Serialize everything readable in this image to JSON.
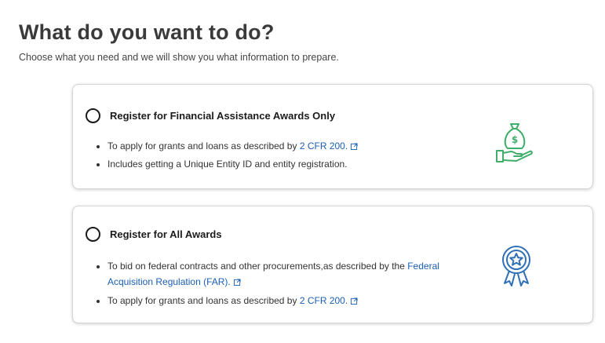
{
  "header": {
    "title": "What do you want to do?",
    "subtitle": "Choose what you need and we will show you what information to prepare."
  },
  "options": [
    {
      "label": "Register for Financial Assistance Awards Only",
      "icon": "money-bag-hand-icon",
      "bullet1_text": "To apply for grants and loans as described by ",
      "bullet1_link": "2 CFR 200.",
      "bullet2_text": "Includes getting a Unique Entity ID and entity registration."
    },
    {
      "label": "Register for All Awards",
      "icon": "award-ribbon-icon",
      "bullet1_text": "To bid on federal contracts and other procurements,as described by the ",
      "bullet1_link": "Federal Acquisition Regulation (FAR).",
      "bullet2_text": "To apply for grants and loans as described by ",
      "bullet2_link": "2 CFR 200."
    }
  ],
  "colors": {
    "link": "#1a5fb4",
    "money_icon": "#3fae6a",
    "award_icon": "#2f6fb8"
  }
}
